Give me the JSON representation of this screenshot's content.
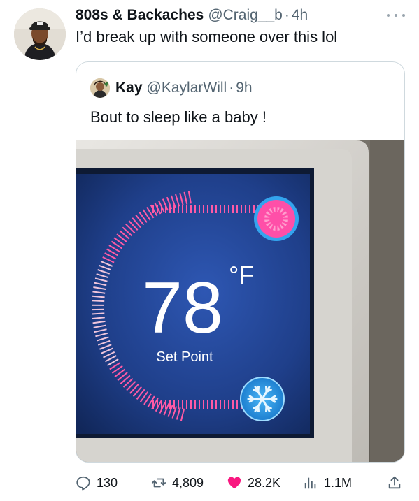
{
  "tweet": {
    "author_name": "808s & Backaches",
    "author_handle": "@Craig__b",
    "separator": "·",
    "time": "4h",
    "text": "I’d break up with someone over this lol"
  },
  "quoted": {
    "author_name": "Kay",
    "author_handle": "@KaylarWill",
    "separator": "·",
    "time": "9h",
    "text": "Bout to sleep like a baby !",
    "media": {
      "temperature": "78",
      "unit": "°F",
      "mode_label": "Set Point"
    }
  },
  "actions": {
    "replies": "130",
    "reposts": "4,809",
    "likes": "28.2K",
    "views": "1.1M"
  },
  "icons": {
    "more": "more-dots-icon",
    "reply": "reply-icon",
    "repost": "repost-icon",
    "like": "heart-icon",
    "views": "views-icon",
    "share": "share-icon",
    "heat": "sun-icon",
    "cool": "snowflake-icon"
  },
  "colors": {
    "like_active": "#f91880",
    "thermo_screen": "#1f3f8a",
    "thermo_arc": "#ff5aa6",
    "heat_button": "#ff4fa8",
    "cool_button": "#3ea5f0"
  }
}
